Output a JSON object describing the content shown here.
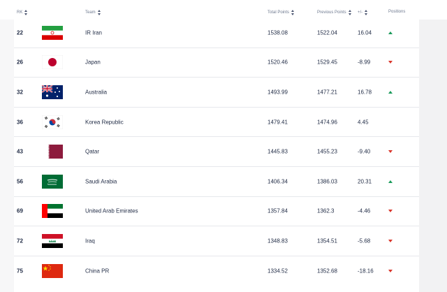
{
  "headers": {
    "rank": "RK",
    "team": "Team",
    "total_points": "Total Points",
    "previous_points": "Previous Points",
    "change": "+/-",
    "positions": "Positions"
  },
  "rows": [
    {
      "rank": "22",
      "team": "IR Iran",
      "total": "1538.08",
      "previous": "1522.04",
      "change": "16.04",
      "movement": "up",
      "flag": "iran-flag-icon"
    },
    {
      "rank": "26",
      "team": "Japan",
      "total": "1520.46",
      "previous": "1529.45",
      "change": "-8.99",
      "movement": "down",
      "flag": "japan-flag-icon"
    },
    {
      "rank": "32",
      "team": "Australia",
      "total": "1493.99",
      "previous": "1477.21",
      "change": "16.78",
      "movement": "up",
      "flag": "australia-flag-icon"
    },
    {
      "rank": "36",
      "team": "Korea Republic",
      "total": "1479.41",
      "previous": "1474.96",
      "change": "4.45",
      "movement": "none",
      "flag": "korea-flag-icon"
    },
    {
      "rank": "43",
      "team": "Qatar",
      "total": "1445.83",
      "previous": "1455.23",
      "change": "-9.40",
      "movement": "down",
      "flag": "qatar-flag-icon"
    },
    {
      "rank": "56",
      "team": "Saudi Arabia",
      "total": "1406.34",
      "previous": "1386.03",
      "change": "20.31",
      "movement": "up",
      "flag": "saudi-arabia-flag-icon"
    },
    {
      "rank": "69",
      "team": "United Arab Emirates",
      "total": "1357.84",
      "previous": "1362.3",
      "change": "-4.46",
      "movement": "down",
      "flag": "uae-flag-icon"
    },
    {
      "rank": "72",
      "team": "Iraq",
      "total": "1348.83",
      "previous": "1354.51",
      "change": "-5.68",
      "movement": "down",
      "flag": "iraq-flag-icon"
    },
    {
      "rank": "75",
      "team": "China PR",
      "total": "1334.52",
      "previous": "1352.68",
      "change": "-18.16",
      "movement": "down",
      "flag": "china-flag-icon"
    }
  ],
  "colors": {
    "up": "#1a9b5a",
    "down": "#d9362b"
  }
}
